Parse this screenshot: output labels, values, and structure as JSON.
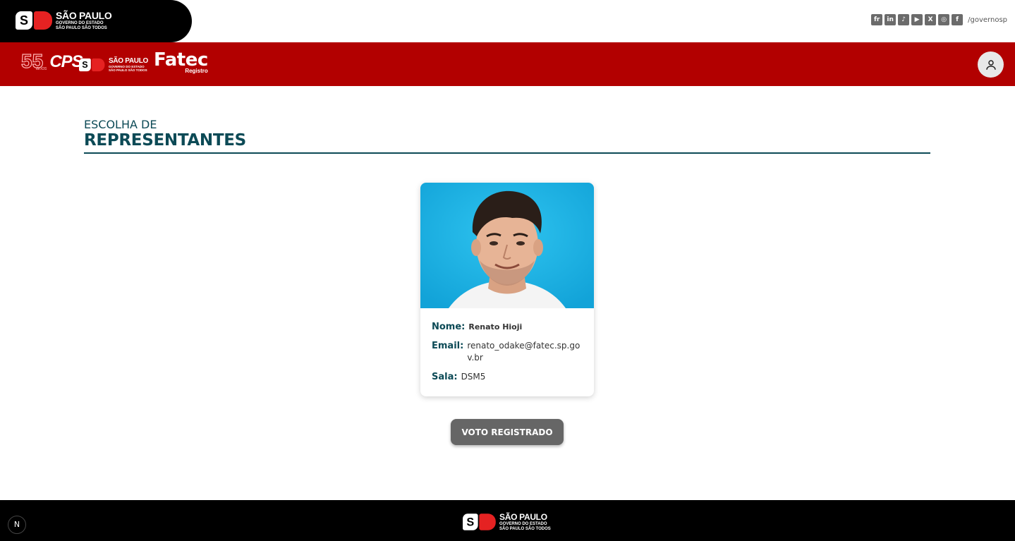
{
  "top_brand": {
    "line1": "SÃO PAULO",
    "line2": "GOVERNO DO ESTADO",
    "line3": "SÃO PAULO SÃO TODOS"
  },
  "social": {
    "icons": [
      "flickr-icon",
      "linkedin-icon",
      "tiktok-icon",
      "youtube-icon",
      "x-icon",
      "instagram-icon",
      "facebook-icon"
    ],
    "handle": "/governosp"
  },
  "header": {
    "cps_years": "55",
    "cps_anos": "anos",
    "cps_name": "CPS",
    "sp_line1": "SÃO PAULO",
    "sp_line2": "GOVERNO DO ESTADO",
    "sp_line3": "SÃO PAULO SÃO TODOS",
    "fatec_title": "Fatec",
    "fatec_sub": "Registro"
  },
  "page": {
    "heading_small": "ESCOLHA DE",
    "heading_big": "REPRESENTANTES"
  },
  "candidate": {
    "name_label": "Nome:",
    "name": "Renato Hioji",
    "email_label": "Email:",
    "email": "renato_odake@fatec.sp.gov.br",
    "room_label": "Sala:",
    "room": "DSM5"
  },
  "vote_button": "VOTO REGISTRADO",
  "footer": {
    "line1": "SÃO PAULO",
    "line2": "GOVERNO DO ESTADO",
    "line3": "SÃO PAULO SÃO TODOS"
  },
  "dev_badge": "N",
  "colors": {
    "brand_red": "#b20000",
    "heading": "#0c4a56",
    "vote_button": "#666666"
  }
}
